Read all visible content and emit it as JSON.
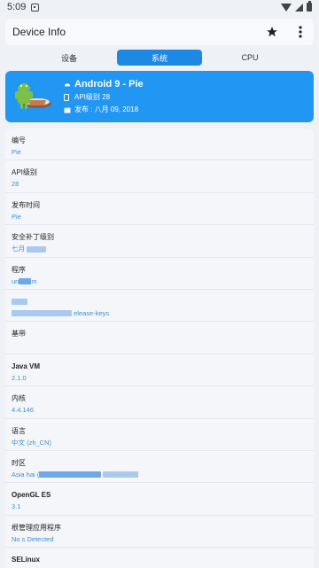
{
  "status_bar": {
    "time": "5:09"
  },
  "app_bar": {
    "title": "Device Info",
    "actions": [
      "star-icon",
      "more-vert-icon"
    ]
  },
  "tabs": [
    {
      "label": "设备",
      "active": false
    },
    {
      "label": "系统",
      "active": true
    },
    {
      "label": "CPU",
      "active": false
    }
  ],
  "header": {
    "title": "Android 9 - Pie",
    "api": "API级别 28",
    "release": "发布 : 八月 09, 2018",
    "accent": "#2196f3"
  },
  "rows": [
    {
      "label": "编号",
      "value": "Pie",
      "bold": false
    },
    {
      "label": "API级别",
      "value": "28",
      "bold": false
    },
    {
      "label": "发布时间",
      "value": "Pie",
      "bold": false
    },
    {
      "label": "安全补丁级别",
      "value": "七月",
      "bold": false
    },
    {
      "label": "程序",
      "value": "un",
      "bold": false
    },
    {
      "label": "",
      "value": "elease-keys",
      "bold": false
    },
    {
      "label": "基带",
      "value": "",
      "bold": false
    },
    {
      "label": "Java VM",
      "value": "2.1.0",
      "bold": true
    },
    {
      "label": "内核",
      "value": "4.4.146",
      "bold": false
    },
    {
      "label": "语言",
      "value": "中文 (zh_CN)",
      "bold": false
    },
    {
      "label": "时区",
      "value": "Asia   hai (",
      "bold": false
    },
    {
      "label": "OpenGL ES",
      "value": "3.1",
      "bold": true
    },
    {
      "label": "根管理应用程序",
      "value": "No     s Detected",
      "bold": false
    },
    {
      "label": "SELinux",
      "value": "",
      "bold": true
    }
  ]
}
